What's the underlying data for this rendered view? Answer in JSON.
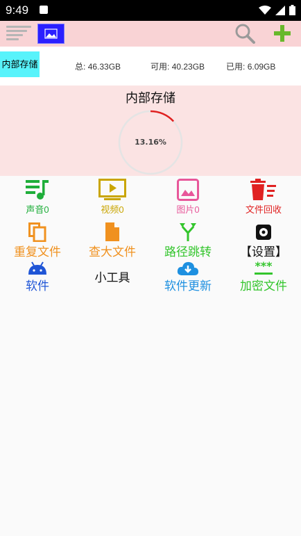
{
  "status_bar": {
    "time": "9:49"
  },
  "storage": {
    "tab_label": "内部存储",
    "total_label": "总:",
    "total_value": "46.33GB",
    "available_label": "可用:",
    "available_value": "40.23GB",
    "used_label": "已用:",
    "used_value": "6.09GB"
  },
  "panel": {
    "title": "内部存储",
    "percent_text": "13.16%",
    "percent_value": 13.16
  },
  "categories": [
    {
      "label": "声音0",
      "color": "#1fae3a",
      "icon": "music-list-icon"
    },
    {
      "label": "视频0",
      "color": "#c9a500",
      "icon": "video-play-icon"
    },
    {
      "label": "图片0",
      "color": "#e8579a",
      "icon": "image-icon"
    },
    {
      "label": "文件回收",
      "color": "#e02222",
      "icon": "trash-icon"
    }
  ],
  "tools_row1": [
    {
      "label": "重复文件",
      "color": "#f0911f",
      "icon": "copy-icon"
    },
    {
      "label": "查大文件",
      "color": "#f0911f",
      "icon": "file-icon"
    },
    {
      "label": "路径跳转",
      "color": "#33c52c",
      "icon": "fork-arrow-icon"
    },
    {
      "label": "【设置】",
      "color": "#111111",
      "icon": "gear-icon"
    }
  ],
  "tools_row2": [
    {
      "label": "软件",
      "color": "#1f55d6",
      "icon": "android-icon"
    },
    {
      "label": "小工具",
      "color": "#111111",
      "icon": ""
    },
    {
      "label": "软件更新",
      "color": "#1e90e0",
      "icon": "cloud-download-icon"
    },
    {
      "label": "加密文件",
      "color": "#33c52c",
      "icon": "password-icon"
    }
  ]
}
